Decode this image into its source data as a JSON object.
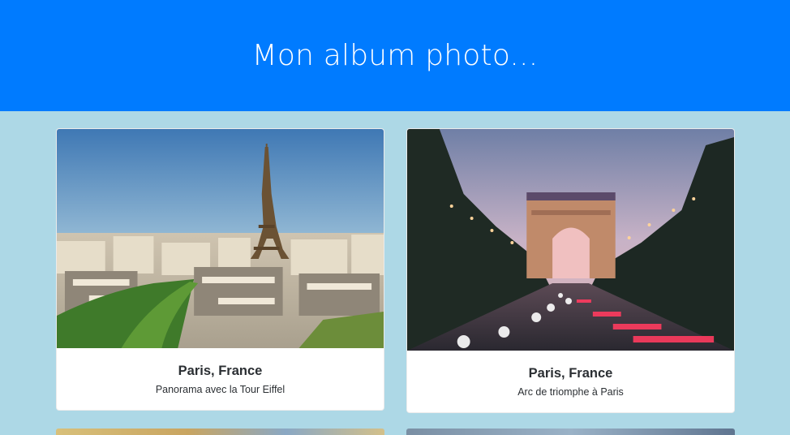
{
  "header": {
    "title": "Mon album photo..."
  },
  "cards": [
    {
      "title": "Paris, France",
      "description": "Panorama avec la Tour Eiffel",
      "image": "eiffel-tower-panorama-photo"
    },
    {
      "title": "Paris, France",
      "description": "Arc de triomphe à Paris",
      "image": "arc-de-triomphe-photo"
    }
  ],
  "colors": {
    "header_bg": "#007bff",
    "page_bg": "#add8e6",
    "card_bg": "#ffffff",
    "text": "#2b2f33"
  }
}
